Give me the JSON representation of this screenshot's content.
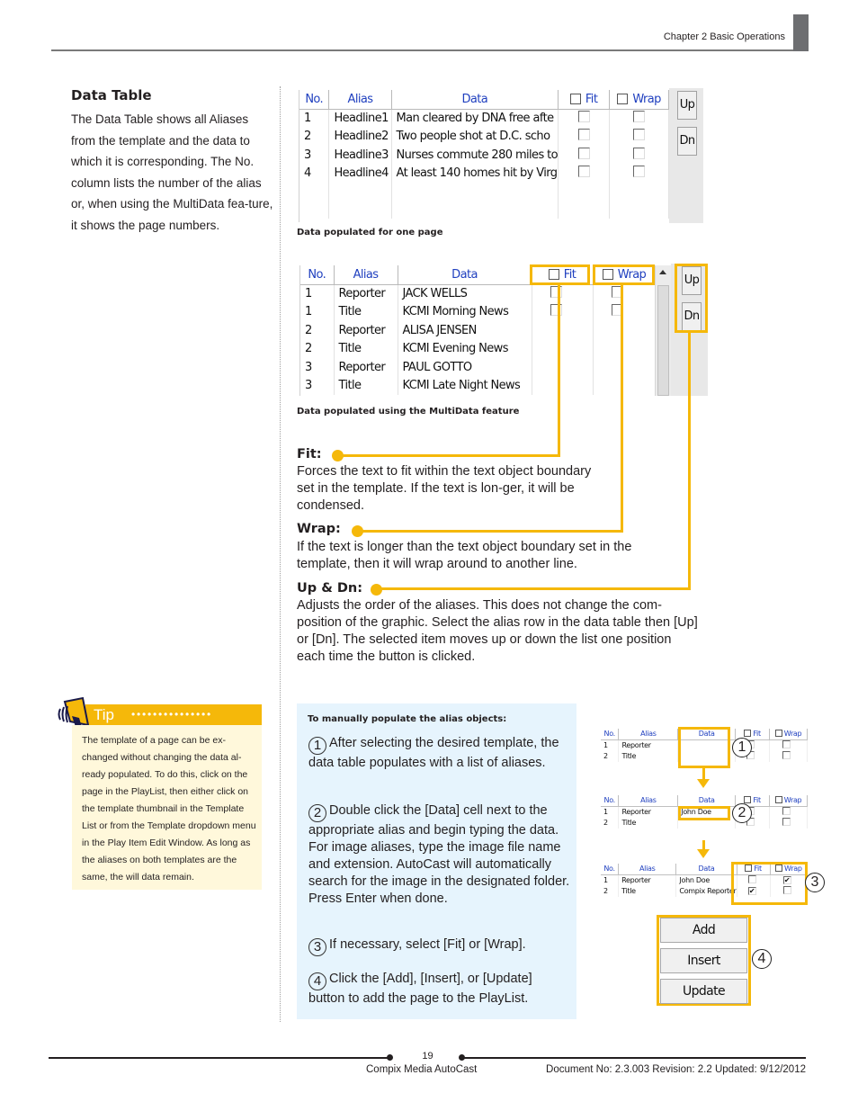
{
  "header": {
    "chapter": "Chapter 2 Basic Operations"
  },
  "section": {
    "title": "Data Table",
    "intro": "The Data Table shows all Aliases from the template and the data to which it is corresponding. The No. column lists the number of the alias or, when using the MultiData fea-ture, it shows the page numbers."
  },
  "table1": {
    "headers": [
      "No.",
      "Alias",
      "Data",
      "Fit",
      "Wrap"
    ],
    "rows": [
      [
        "1",
        "Headline1",
        "Man cleared by DNA free afte"
      ],
      [
        "2",
        "Headline2",
        "Two people shot at D.C. scho"
      ],
      [
        "3",
        "Headline3",
        "Nurses commute 280 miles to"
      ],
      [
        "4",
        "Headline4",
        "At least 140 homes hit by Virg"
      ]
    ],
    "up_label": "Up",
    "dn_label": "Dn",
    "caption": "Data populated for one page"
  },
  "table2": {
    "headers": [
      "No.",
      "Alias",
      "Data",
      "Fit",
      "Wrap"
    ],
    "rows": [
      [
        "1",
        "Reporter",
        "JACK WELLS"
      ],
      [
        "1",
        "Title",
        "KCMI Morning News"
      ],
      [
        "2",
        "Reporter",
        "ALISA JENSEN"
      ],
      [
        "2",
        "Title",
        "KCMI Evening News"
      ],
      [
        "3",
        "Reporter",
        "PAUL GOTTO"
      ],
      [
        "3",
        "Title",
        "KCMI Late Night News"
      ]
    ],
    "up_label": "Up",
    "dn_label": "Dn",
    "caption": "Data populated using the MultiData feature"
  },
  "definitions": {
    "fit_term": "Fit:",
    "fit_desc": "Forces the text to fit within the text object boundary set in the template. If the text is lon-ger, it will be condensed.",
    "wrap_term": "Wrap:",
    "wrap_desc": "If the text is longer than the text object boundary set in the template, then it will wrap around to another line.",
    "updn_term": "Up & Dn:",
    "updn_desc": "Adjusts the order of the aliases. This does not change the com-position of the graphic. Select the alias row in the data table then [Up] or [Dn]. The selected item moves up or down the list one position each time the button is clicked."
  },
  "tip": {
    "label": "Tip",
    "dots": "•••••••••••••••",
    "text": "The template of a page can be ex-changed without changing the data al-ready populated. To do this, click on the page in the PlayList, then either click on the template thumbnail in the Template List or from the Template dropdown menu in the Play Item Edit Window. As long as the aliases on both templates are the same, the will data remain."
  },
  "procedure": {
    "title": "To manually populate the alias objects:",
    "steps": [
      {
        "num": "1",
        "text": "After selecting the desired template, the data table populates with a list of aliases."
      },
      {
        "num": "2",
        "text": "Double click the [Data] cell next to the appropriate alias and begin typing the data. For image aliases, type the image file name and extension. AutoCast will automatically search for the image in the designated folder. Press Enter when done."
      },
      {
        "num": "3",
        "text": "If necessary, select [Fit] or [Wrap]."
      },
      {
        "num": "4",
        "text": "Click the [Add], [Insert], or [Update] button to add the page to the PlayList."
      }
    ]
  },
  "mini": {
    "headers": [
      "No.",
      "Alias",
      "Data",
      "Fit",
      "Wrap"
    ],
    "m1": [
      [
        "1",
        "Reporter",
        ""
      ],
      [
        "2",
        "Title",
        ""
      ]
    ],
    "m2": [
      [
        "1",
        "Reporter",
        "John Doe"
      ],
      [
        "2",
        "Title",
        ""
      ]
    ],
    "m3": [
      [
        "1",
        "Reporter",
        "John Doe"
      ],
      [
        "2",
        "Title",
        "Compix Reporter"
      ]
    ],
    "labels": [
      "1",
      "2",
      "3",
      "4"
    ],
    "check": "✔"
  },
  "action_buttons": {
    "add": "Add",
    "insert": "Insert",
    "update": "Update"
  },
  "footer": {
    "page": "19",
    "product": "Compix Media AutoCast",
    "doc": "Document No: 2.3.003 Revision: 2.2 Updated: 9/12/2012"
  },
  "colors": {
    "accent": "#f5b80a",
    "tip_bg": "#fff8db",
    "procedure_bg": "#e6f4fd",
    "header_blue": "#1f3fbf"
  }
}
